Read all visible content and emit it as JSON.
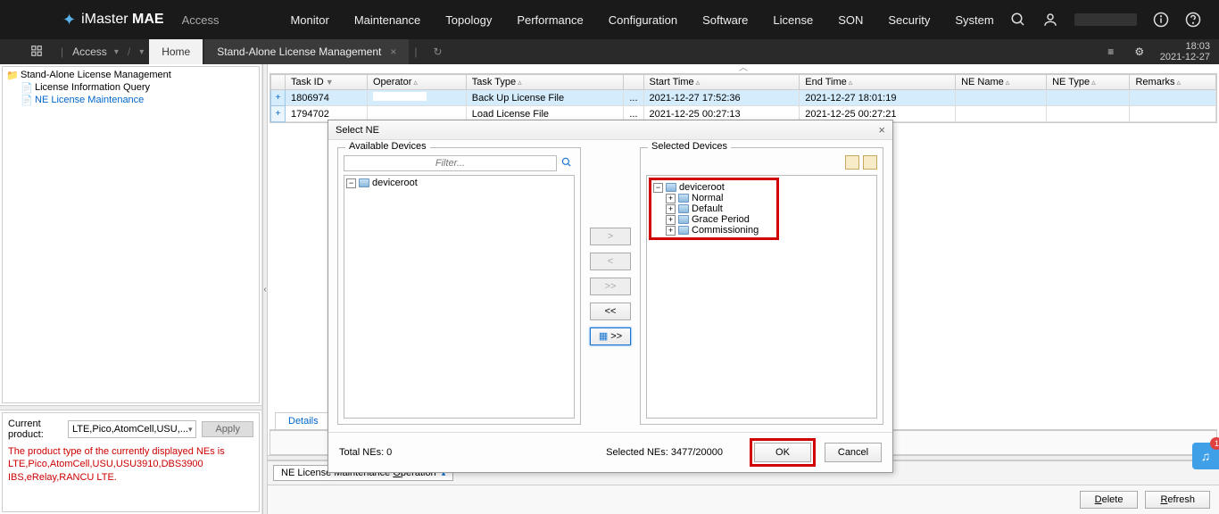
{
  "header": {
    "logo_pre": "iMaster ",
    "logo_bold": "MAE",
    "access": "Access",
    "nav": [
      "Monitor",
      "Maintenance",
      "Topology",
      "Performance",
      "Configuration",
      "Software",
      "License",
      "SON",
      "Security",
      "System"
    ],
    "time": "18:03",
    "date": "2021-12-27"
  },
  "secondbar": {
    "breadcrumb": "Access",
    "tab_home": "Home",
    "tab_current": "Stand-Alone License Management"
  },
  "left_tree": {
    "root": "Stand-Alone License Management",
    "child1": "License Information Query",
    "child2": "NE License Maintenance"
  },
  "product_panel": {
    "label": "Current product:",
    "value": "LTE,Pico,AtomCell,USU,...",
    "apply": "Apply",
    "warn": "The product type of the currently displayed NEs is LTE,Pico,AtomCell,USU,USU3910,DBS3900 IBS,eRelay,RANCU LTE."
  },
  "table": {
    "cols": [
      "Task ID",
      "Operator",
      "Task Type",
      "Start Time",
      "End Time",
      "NE Name",
      "NE Type",
      "Remarks"
    ],
    "rows": [
      {
        "id": "1806974",
        "op": "",
        "type": "Back Up License File",
        "dots": "...",
        "start": "2021-12-27 17:52:36",
        "end": "2021-12-27 18:01:19"
      },
      {
        "id": "1794702",
        "op": "",
        "type": "Load License File",
        "dots": "...",
        "start": "2021-12-25 00:27:13",
        "end": "2021-12-25 00:27:21"
      }
    ]
  },
  "details_tab": "Details",
  "op_menu": "NE License Maintenance Operation",
  "buttons": {
    "delete": "Delete",
    "refresh": "Refresh"
  },
  "dialog": {
    "title": "Select NE",
    "available_legend": "Available Devices",
    "selected_legend": "Selected Devices",
    "filter_placeholder": "Filter...",
    "root": "deviceroot",
    "selected_items": [
      "Normal",
      "Default",
      "Grace Period",
      "Commissioning"
    ],
    "transfer": {
      "r": ">",
      "l": "<",
      "rr": ">>",
      "ll": "<<",
      "special": ">>"
    },
    "total": "Total NEs: 0",
    "selected_count": "Selected NEs: 3477/20000",
    "ok": "OK",
    "cancel": "Cancel"
  },
  "fab_badge": "1"
}
